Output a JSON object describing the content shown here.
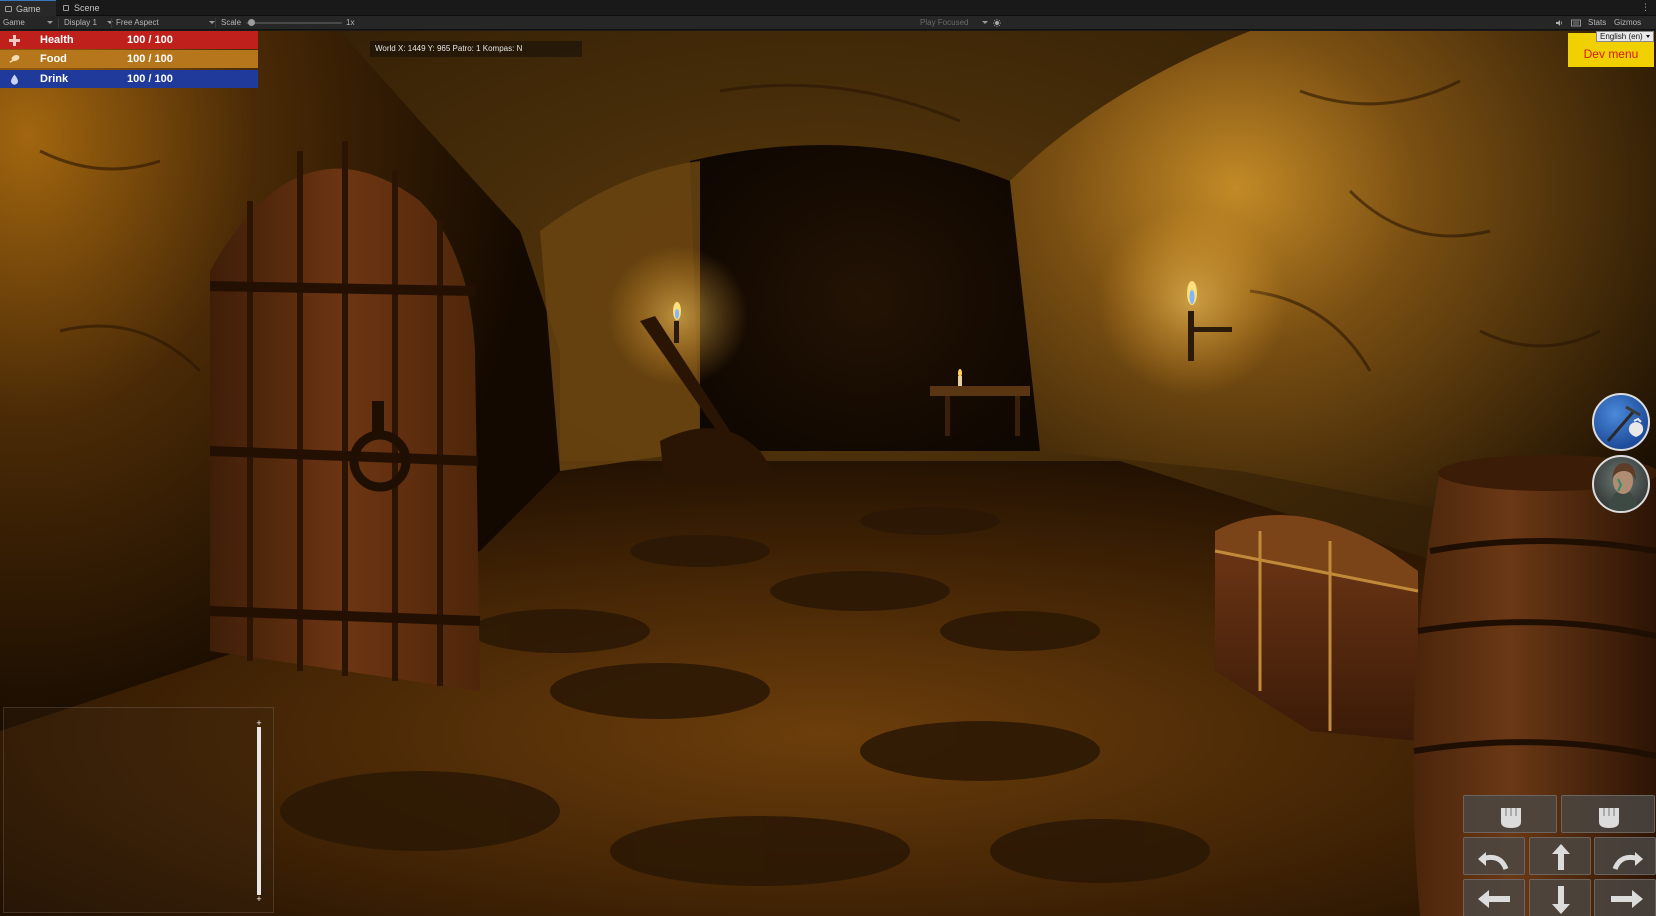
{
  "editor": {
    "tabs": [
      "Game",
      "Scene"
    ],
    "toolbar": {
      "view": "Game",
      "display": "Display 1",
      "aspect": "Free Aspect",
      "scale_label": "Scale",
      "scale_value": "1x",
      "scale_fraction": 0.02,
      "play_mode": "Play Focused",
      "stats": "Stats",
      "gizmos": "Gizmos"
    }
  },
  "hud": {
    "stats": [
      {
        "name": "Health",
        "value": "100 / 100",
        "color": "#c0201c",
        "icon": "cross-icon"
      },
      {
        "name": "Food",
        "value": "100 / 100",
        "color": "#b6771c",
        "icon": "drumstick-icon"
      },
      {
        "name": "Drink",
        "value": "100 / 100",
        "color": "#1f3a9a",
        "icon": "droplet-icon"
      }
    ],
    "coords": "World X: 1449 Y: 965 Patro: 1 Kompas: N",
    "language": "English (en)",
    "dev_menu": "Dev menu",
    "dev_menu_colors": {
      "bg": "#f0d000",
      "fg": "#d21b1b"
    },
    "side_buttons": [
      "pickaxe-bag-icon",
      "character-portrait"
    ],
    "controls": {
      "row1": [
        "left-fist-icon",
        "right-fist-icon"
      ],
      "row2": [
        "turn-left-icon",
        "move-forward-icon",
        "turn-right-icon"
      ],
      "row3": [
        "strafe-left-icon",
        "move-back-icon",
        "strafe-right-icon"
      ]
    }
  }
}
